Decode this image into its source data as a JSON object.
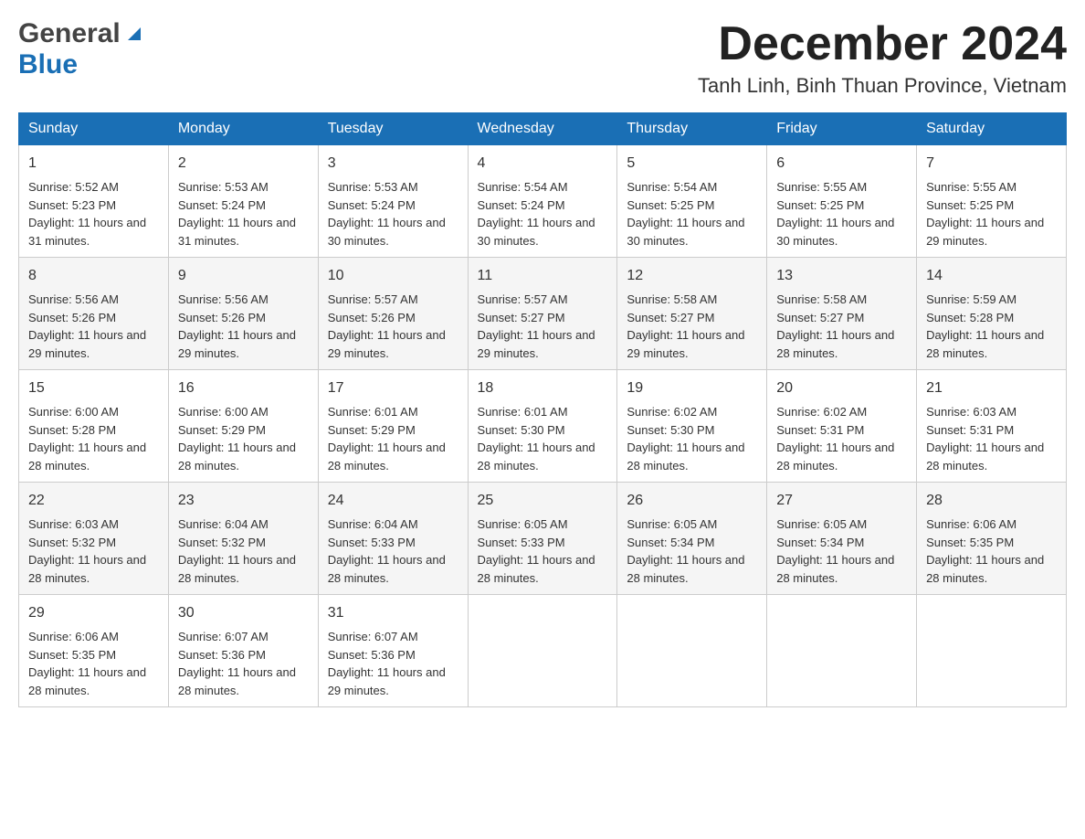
{
  "header": {
    "logo_general": "General",
    "logo_blue": "Blue",
    "month_title": "December 2024",
    "location": "Tanh Linh, Binh Thuan Province, Vietnam"
  },
  "days_of_week": [
    "Sunday",
    "Monday",
    "Tuesday",
    "Wednesday",
    "Thursday",
    "Friday",
    "Saturday"
  ],
  "weeks": [
    [
      {
        "day": "1",
        "sunrise": "5:52 AM",
        "sunset": "5:23 PM",
        "daylight": "11 hours and 31 minutes."
      },
      {
        "day": "2",
        "sunrise": "5:53 AM",
        "sunset": "5:24 PM",
        "daylight": "11 hours and 31 minutes."
      },
      {
        "day": "3",
        "sunrise": "5:53 AM",
        "sunset": "5:24 PM",
        "daylight": "11 hours and 30 minutes."
      },
      {
        "day": "4",
        "sunrise": "5:54 AM",
        "sunset": "5:24 PM",
        "daylight": "11 hours and 30 minutes."
      },
      {
        "day": "5",
        "sunrise": "5:54 AM",
        "sunset": "5:25 PM",
        "daylight": "11 hours and 30 minutes."
      },
      {
        "day": "6",
        "sunrise": "5:55 AM",
        "sunset": "5:25 PM",
        "daylight": "11 hours and 30 minutes."
      },
      {
        "day": "7",
        "sunrise": "5:55 AM",
        "sunset": "5:25 PM",
        "daylight": "11 hours and 29 minutes."
      }
    ],
    [
      {
        "day": "8",
        "sunrise": "5:56 AM",
        "sunset": "5:26 PM",
        "daylight": "11 hours and 29 minutes."
      },
      {
        "day": "9",
        "sunrise": "5:56 AM",
        "sunset": "5:26 PM",
        "daylight": "11 hours and 29 minutes."
      },
      {
        "day": "10",
        "sunrise": "5:57 AM",
        "sunset": "5:26 PM",
        "daylight": "11 hours and 29 minutes."
      },
      {
        "day": "11",
        "sunrise": "5:57 AM",
        "sunset": "5:27 PM",
        "daylight": "11 hours and 29 minutes."
      },
      {
        "day": "12",
        "sunrise": "5:58 AM",
        "sunset": "5:27 PM",
        "daylight": "11 hours and 29 minutes."
      },
      {
        "day": "13",
        "sunrise": "5:58 AM",
        "sunset": "5:27 PM",
        "daylight": "11 hours and 28 minutes."
      },
      {
        "day": "14",
        "sunrise": "5:59 AM",
        "sunset": "5:28 PM",
        "daylight": "11 hours and 28 minutes."
      }
    ],
    [
      {
        "day": "15",
        "sunrise": "6:00 AM",
        "sunset": "5:28 PM",
        "daylight": "11 hours and 28 minutes."
      },
      {
        "day": "16",
        "sunrise": "6:00 AM",
        "sunset": "5:29 PM",
        "daylight": "11 hours and 28 minutes."
      },
      {
        "day": "17",
        "sunrise": "6:01 AM",
        "sunset": "5:29 PM",
        "daylight": "11 hours and 28 minutes."
      },
      {
        "day": "18",
        "sunrise": "6:01 AM",
        "sunset": "5:30 PM",
        "daylight": "11 hours and 28 minutes."
      },
      {
        "day": "19",
        "sunrise": "6:02 AM",
        "sunset": "5:30 PM",
        "daylight": "11 hours and 28 minutes."
      },
      {
        "day": "20",
        "sunrise": "6:02 AM",
        "sunset": "5:31 PM",
        "daylight": "11 hours and 28 minutes."
      },
      {
        "day": "21",
        "sunrise": "6:03 AM",
        "sunset": "5:31 PM",
        "daylight": "11 hours and 28 minutes."
      }
    ],
    [
      {
        "day": "22",
        "sunrise": "6:03 AM",
        "sunset": "5:32 PM",
        "daylight": "11 hours and 28 minutes."
      },
      {
        "day": "23",
        "sunrise": "6:04 AM",
        "sunset": "5:32 PM",
        "daylight": "11 hours and 28 minutes."
      },
      {
        "day": "24",
        "sunrise": "6:04 AM",
        "sunset": "5:33 PM",
        "daylight": "11 hours and 28 minutes."
      },
      {
        "day": "25",
        "sunrise": "6:05 AM",
        "sunset": "5:33 PM",
        "daylight": "11 hours and 28 minutes."
      },
      {
        "day": "26",
        "sunrise": "6:05 AM",
        "sunset": "5:34 PM",
        "daylight": "11 hours and 28 minutes."
      },
      {
        "day": "27",
        "sunrise": "6:05 AM",
        "sunset": "5:34 PM",
        "daylight": "11 hours and 28 minutes."
      },
      {
        "day": "28",
        "sunrise": "6:06 AM",
        "sunset": "5:35 PM",
        "daylight": "11 hours and 28 minutes."
      }
    ],
    [
      {
        "day": "29",
        "sunrise": "6:06 AM",
        "sunset": "5:35 PM",
        "daylight": "11 hours and 28 minutes."
      },
      {
        "day": "30",
        "sunrise": "6:07 AM",
        "sunset": "5:36 PM",
        "daylight": "11 hours and 28 minutes."
      },
      {
        "day": "31",
        "sunrise": "6:07 AM",
        "sunset": "5:36 PM",
        "daylight": "11 hours and 29 minutes."
      },
      null,
      null,
      null,
      null
    ]
  ]
}
